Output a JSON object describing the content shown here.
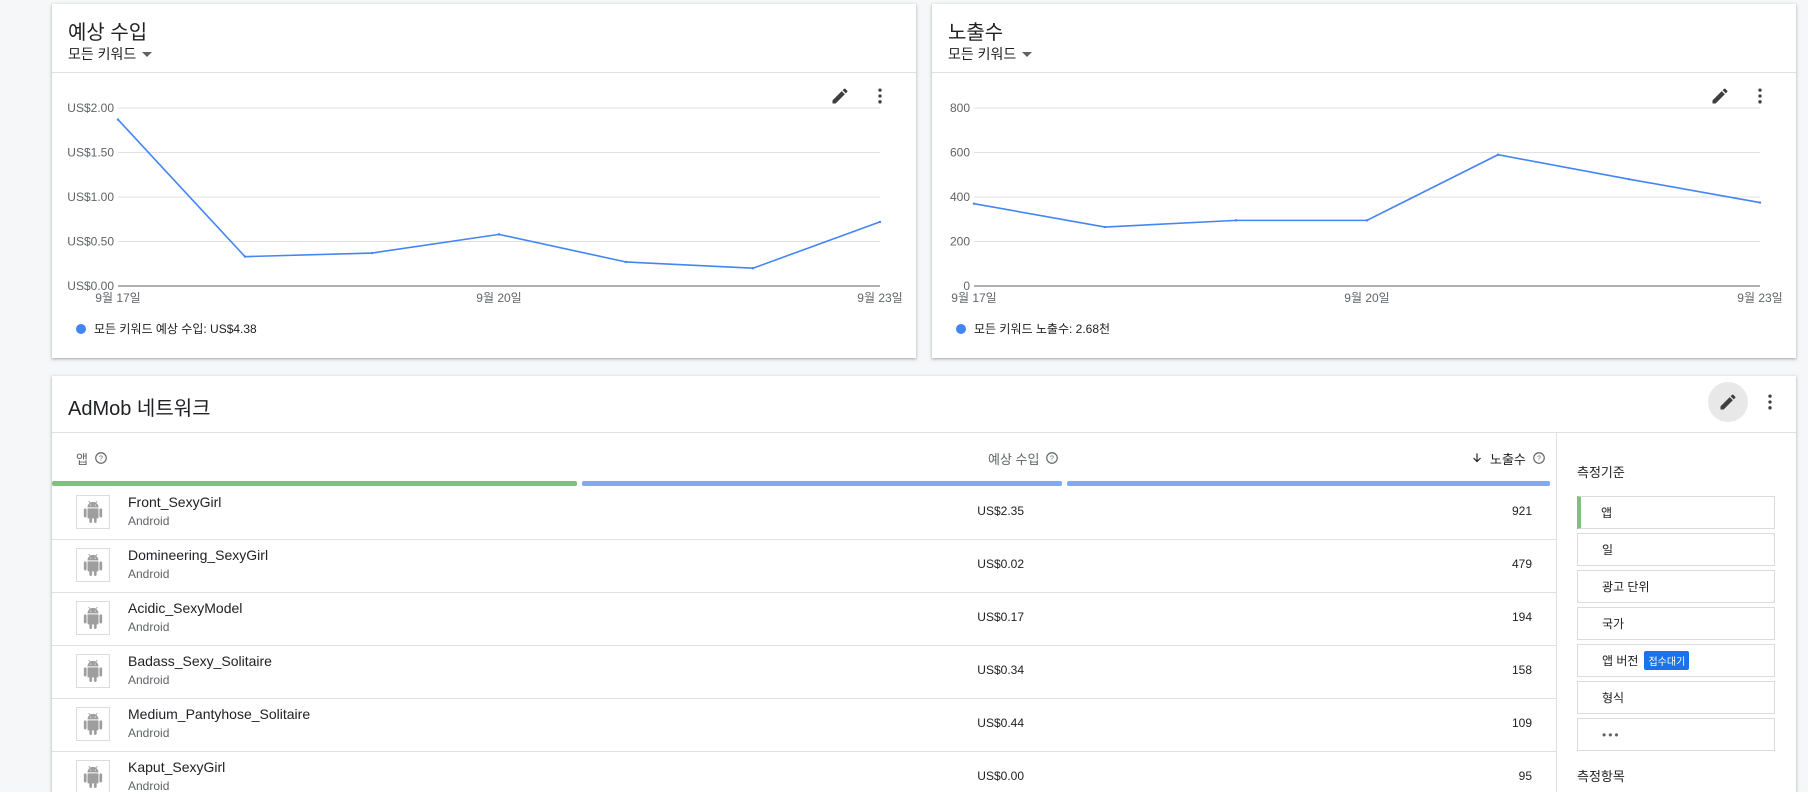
{
  "revenue_card": {
    "title": "예상 수입",
    "filter": "모든 키워드",
    "legend": "모든 키워드 예상 수입: US$4.38",
    "chart_data": {
      "type": "line",
      "x": [
        "9월 17일",
        "9월 18일",
        "9월 19일",
        "9월 20일",
        "9월 21일",
        "9월 22일",
        "9월 23일"
      ],
      "x_tick_labels": [
        "9월 17일",
        "9월 20일",
        "9월 23일"
      ],
      "y_ticks": [
        "US$0.00",
        "US$0.50",
        "US$1.00",
        "US$1.50",
        "US$2.00"
      ],
      "ylim": [
        0,
        2
      ],
      "series": [
        {
          "name": "모든 키워드",
          "values": [
            1.87,
            0.33,
            0.37,
            0.58,
            0.27,
            0.2,
            0.72
          ]
        }
      ],
      "color": "#4285f4"
    }
  },
  "impressions_card": {
    "title": "노출수",
    "filter": "모든 키워드",
    "legend": "모든 키워드 노출수: 2.68천",
    "chart_data": {
      "type": "line",
      "x": [
        "9월 17일",
        "9월 18일",
        "9월 19일",
        "9월 20일",
        "9월 21일",
        "9월 22일",
        "9월 23일"
      ],
      "x_tick_labels": [
        "9월 17일",
        "9월 20일",
        "9월 23일"
      ],
      "y_ticks": [
        "0",
        "200",
        "400",
        "600",
        "800"
      ],
      "ylim": [
        0,
        800
      ],
      "series": [
        {
          "name": "모든 키워드",
          "values": [
            370,
            265,
            295,
            295,
            590,
            480,
            375
          ]
        }
      ],
      "color": "#4285f4"
    }
  },
  "network_card": {
    "title": "AdMob 네트워크",
    "columns": {
      "app": "앱",
      "revenue": "예상 수입",
      "impressions": "노출수"
    },
    "rows": [
      {
        "name": "Front_SexyGirl",
        "os": "Android",
        "revenue": "US$2.35",
        "impressions": "921"
      },
      {
        "name": "Domineering_SexyGirl",
        "os": "Android",
        "revenue": "US$0.02",
        "impressions": "479"
      },
      {
        "name": "Acidic_SexyModel",
        "os": "Android",
        "revenue": "US$0.17",
        "impressions": "194"
      },
      {
        "name": "Badass_Sexy_Solitaire",
        "os": "Android",
        "revenue": "US$0.34",
        "impressions": "158"
      },
      {
        "name": "Medium_Pantyhose_Solitaire",
        "os": "Android",
        "revenue": "US$0.44",
        "impressions": "109"
      },
      {
        "name": "Kaput_SexyGirl",
        "os": "Android",
        "revenue": "US$0.00",
        "impressions": "95"
      }
    ],
    "side": {
      "dimensions_title": "측정기준",
      "dimensions": [
        "앱",
        "일",
        "광고 단위",
        "국가",
        "앱 버전",
        "형식",
        "•••"
      ],
      "badge": "접수대기",
      "metrics_title": "측정항목"
    },
    "column_bar_colors": [
      "#7cc27e",
      "#7baaf7",
      "#7baaf7"
    ]
  },
  "icons": [
    "pencil-icon",
    "more-vert-icon",
    "help-circle-icon",
    "arrow-down-icon",
    "android-icon"
  ]
}
